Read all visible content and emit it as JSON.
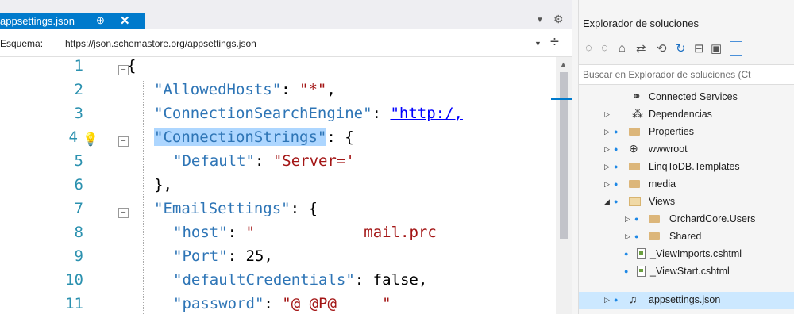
{
  "tab": {
    "title": "appsettings.json",
    "pin": "⊕",
    "close": "✕"
  },
  "schema": {
    "label": "Esquema:",
    "url": "https://json.schemastore.org/appsettings.json"
  },
  "code": {
    "line_numbers": [
      "1",
      "2",
      "3",
      "4",
      "5",
      "6",
      "7",
      "8",
      "9",
      "10",
      "11"
    ],
    "lines": [
      [
        {
          "t": "{",
          "c": "p"
        }
      ],
      [
        {
          "t": "\"AllowedHosts\"",
          "c": "k"
        },
        {
          "t": ": ",
          "c": "p"
        },
        {
          "t": "\"*\"",
          "c": "s"
        },
        {
          "t": ",",
          "c": "p"
        }
      ],
      [
        {
          "t": "\"ConnectionSearchEngine\"",
          "c": "k"
        },
        {
          "t": ": ",
          "c": "p"
        },
        {
          "t": "\"http:/,",
          "c": "lnk"
        }
      ],
      [
        {
          "t": "\"ConnectionStrings\"",
          "c": "k sel"
        },
        {
          "t": ": {",
          "c": "p"
        }
      ],
      [
        {
          "t": "\"Default\"",
          "c": "k"
        },
        {
          "t": ": ",
          "c": "p"
        },
        {
          "t": "\"Server='",
          "c": "s"
        }
      ],
      [
        {
          "t": "},",
          "c": "p"
        }
      ],
      [
        {
          "t": "\"EmailSettings\"",
          "c": "k"
        },
        {
          "t": ": {",
          "c": "p"
        }
      ],
      [
        {
          "t": "\"host\"",
          "c": "k"
        },
        {
          "t": ": ",
          "c": "p"
        },
        {
          "t": "\"",
          "c": "s"
        },
        {
          "t": "            mail.prc",
          "c": "s"
        }
      ],
      [
        {
          "t": "\"Port\"",
          "c": "k"
        },
        {
          "t": ": 25,",
          "c": "p"
        }
      ],
      [
        {
          "t": "\"defaultCredentials\"",
          "c": "k"
        },
        {
          "t": ": false,",
          "c": "p"
        }
      ],
      [
        {
          "t": "\"password\"",
          "c": "k"
        },
        {
          "t": ": ",
          "c": "p"
        },
        {
          "t": "\"@ @P@     \"",
          "c": "s"
        }
      ]
    ]
  },
  "explorer": {
    "title": "Explorador de soluciones",
    "toolbar_icons": [
      "back-icon",
      "forward-icon",
      "home-icon",
      "sync-icon",
      "history-icon",
      "refresh-icon",
      "collapse-icon",
      "show-all-icon"
    ],
    "search_placeholder": "Buscar en Explorador de soluciones (Ct",
    "items": [
      {
        "label": "Connected Services",
        "icon": "connected-services-icon",
        "level": 1
      },
      {
        "label": "Dependencias",
        "icon": "dependencies-icon",
        "level": 1
      },
      {
        "label": "Properties",
        "icon": "properties-folder-icon",
        "level": 1
      },
      {
        "label": "wwwroot",
        "icon": "globe-icon",
        "level": 1
      },
      {
        "label": "LinqToDB.Templates",
        "icon": "folder-icon",
        "level": 1
      },
      {
        "label": "media",
        "icon": "folder-icon",
        "level": 1
      },
      {
        "label": "Views",
        "icon": "open-folder-icon",
        "level": 1
      },
      {
        "label": "OrchardCore.Users",
        "icon": "folder-icon",
        "level": 2
      },
      {
        "label": "Shared",
        "icon": "folder-icon",
        "level": 2
      },
      {
        "label": "_ViewImports.cshtml",
        "icon": "razor-file-icon",
        "level": 2
      },
      {
        "label": "_ViewStart.cshtml",
        "icon": "razor-file-icon",
        "level": 2
      },
      {
        "label": "appsettings.json",
        "icon": "json-file-icon",
        "level": 1
      }
    ]
  }
}
